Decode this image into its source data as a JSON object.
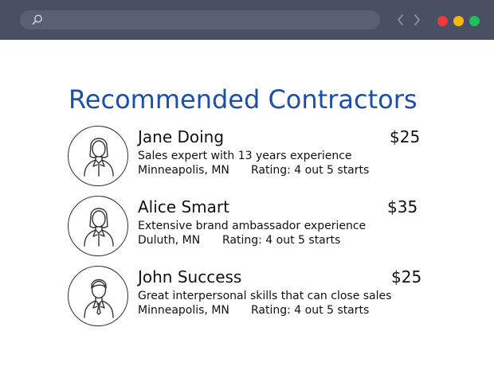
{
  "browser": {
    "search_icon": "search-icon",
    "nav_icons": [
      "chevron-left-icon",
      "chevron-right-icon"
    ],
    "window_controls": {
      "red": "#f03a3a",
      "yellow": "#f5b70c",
      "green": "#22c05a"
    }
  },
  "page": {
    "title": "Recommended Contractors",
    "title_color": "#1f4fa3"
  },
  "contractors": [
    {
      "name": "Jane Doing",
      "price": "$25",
      "description": "Sales expert with 13 years experience",
      "location": "Minneapolis, MN",
      "rating": "Rating: 4 out 5 starts",
      "avatar_icon": "female-avatar-icon"
    },
    {
      "name": "Alice Smart",
      "price": "$35",
      "description": "Extensive brand ambassador experience",
      "location": "Duluth, MN",
      "rating": "Rating: 4 out 5 starts",
      "avatar_icon": "female-avatar-icon"
    },
    {
      "name": "John Success",
      "price": "$25",
      "description": "Great interpersonal skills that can close sales",
      "location": "Minneapolis, MN",
      "rating": "Rating: 4 out 5 starts",
      "avatar_icon": "male-avatar-icon"
    }
  ]
}
